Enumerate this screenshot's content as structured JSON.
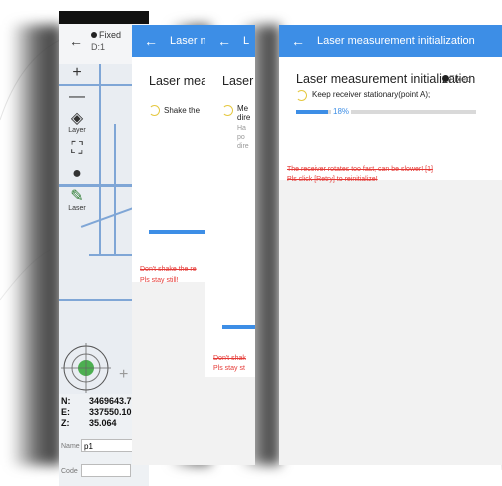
{
  "map_screen": {
    "status": "Fixed",
    "mode": "D:1",
    "tools": [
      {
        "icon": "zoom-in-icon",
        "glyph": "+",
        "label": ""
      },
      {
        "icon": "zoom-out-icon",
        "glyph": "—",
        "label": ""
      },
      {
        "icon": "layer-icon",
        "glyph": "◈",
        "label": "Layer"
      },
      {
        "icon": "fullscreen-icon",
        "glyph": "⛶",
        "label": ""
      },
      {
        "icon": "locate-icon",
        "glyph": "●",
        "label": ""
      },
      {
        "icon": "laser-icon",
        "glyph": "✎",
        "label": "Laser"
      }
    ],
    "coords": [
      {
        "label": "N:",
        "value": "3469643.7"
      },
      {
        "label": "E:",
        "value": "337550.10"
      },
      {
        "label": "Z:",
        "value": "35.064"
      }
    ],
    "name_label": "Name",
    "name_value": "p1",
    "code_label": "Code",
    "code_value": ""
  },
  "card1": {
    "header": "Laser me",
    "title": "Laser meas",
    "instruction": "Shake the",
    "warning_line1": "Don't shake the re",
    "warning_line2": "Pls stay still!"
  },
  "card2": {
    "header": "L",
    "title": "Laser",
    "instruction": "Me",
    "instruction2": "dire",
    "sub1": "Ha",
    "sub2": "po",
    "sub3": "dire",
    "warning_line1": "Don't shak",
    "warning_line2": "Pls stay st"
  },
  "card3": {
    "header": "Laser measurement initialization",
    "title": "Laser measurement initialization",
    "status": "Fixed",
    "instruction": "Keep receiver stationary(point A);",
    "progress_label": "18%",
    "progress": 0.18,
    "warning_line1": "The receiver rotates too fast, can be slower! [1]",
    "warning_line2": "Pls click [Retry] to reinitialize!"
  },
  "colors": {
    "accent": "#3d8ee6",
    "warning": "#e53935",
    "spinner": "#e5c840"
  }
}
